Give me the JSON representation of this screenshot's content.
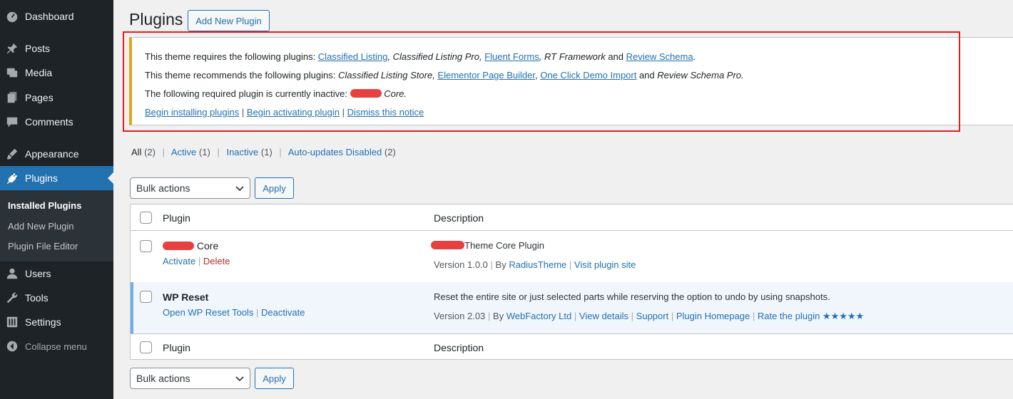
{
  "sidebar": {
    "items": [
      {
        "label": "Dashboard",
        "icon": "dashboard-icon"
      },
      {
        "label": "Posts",
        "icon": "pin-icon"
      },
      {
        "label": "Media",
        "icon": "media-icon"
      },
      {
        "label": "Pages",
        "icon": "pages-icon"
      },
      {
        "label": "Comments",
        "icon": "comment-icon"
      },
      {
        "label": "Appearance",
        "icon": "brush-icon"
      },
      {
        "label": "Plugins",
        "icon": "plug-icon"
      },
      {
        "label": "Users",
        "icon": "user-icon"
      },
      {
        "label": "Tools",
        "icon": "wrench-icon"
      },
      {
        "label": "Settings",
        "icon": "settings-icon"
      },
      {
        "label": "Collapse menu",
        "icon": "collapse-icon"
      }
    ],
    "submenu": [
      "Installed Plugins",
      "Add New Plugin",
      "Plugin File Editor"
    ]
  },
  "header": {
    "title": "Plugins",
    "add_new": "Add New Plugin"
  },
  "notice": {
    "req_prefix": "This theme requires the following plugins: ",
    "req_1": "Classified Listing",
    "req_2": ", Classified Listing Pro, ",
    "req_3": "Fluent Forms",
    "req_4": ", RT Framework",
    "req_and": " and ",
    "req_5": "Review Schema",
    "req_end": ".",
    "rec_prefix": "This theme recommends the following plugins: ",
    "rec_1": "Classified Listing Store, ",
    "rec_2": "Elementor Page Builder",
    "rec_sep": ", ",
    "rec_3": "One Click Demo Import",
    "rec_and": " and ",
    "rec_4": "Review Schema Pro.",
    "inactive_prefix": "The following required plugin is currently inactive: ",
    "inactive_suffix": " Core.",
    "link_install": "Begin installing plugins",
    "link_activate": "Begin activating plugin",
    "link_dismiss": "Dismiss this notice",
    "sep": "|"
  },
  "filters": {
    "all": "All",
    "all_count": "(2)",
    "active": "Active",
    "active_count": "(1)",
    "inactive": "Inactive",
    "inactive_count": "(1)",
    "auto": "Auto-updates Disabled",
    "auto_count": "(2)",
    "sep": "|"
  },
  "bulk": {
    "select": "Bulk actions",
    "apply": "Apply"
  },
  "table": {
    "col_plugin": "Plugin",
    "col_desc": "Description",
    "rows": [
      {
        "name": "Core",
        "activate": "Activate",
        "delete": "Delete",
        "desc": "Theme Core Plugin",
        "version": "Version 1.0.0",
        "by": "By",
        "author": "RadiusTheme",
        "visit": "Visit plugin site"
      },
      {
        "name": "WP Reset",
        "tools": "Open WP Reset Tools",
        "deactivate": "Deactivate",
        "desc": "Reset the entire site or just selected parts while reserving the option to undo by using snapshots.",
        "version": "Version 2.03",
        "by": "By",
        "author": "WebFactory Ltd",
        "details": "View details",
        "support": "Support",
        "homepage": "Plugin Homepage",
        "rate": "Rate the plugin ★★★★★"
      }
    ]
  },
  "colors": {
    "sidebar_bg": "#1d2327",
    "accent": "#2271b1",
    "notice_border": "#dba617",
    "highlight": "#e0201f"
  }
}
